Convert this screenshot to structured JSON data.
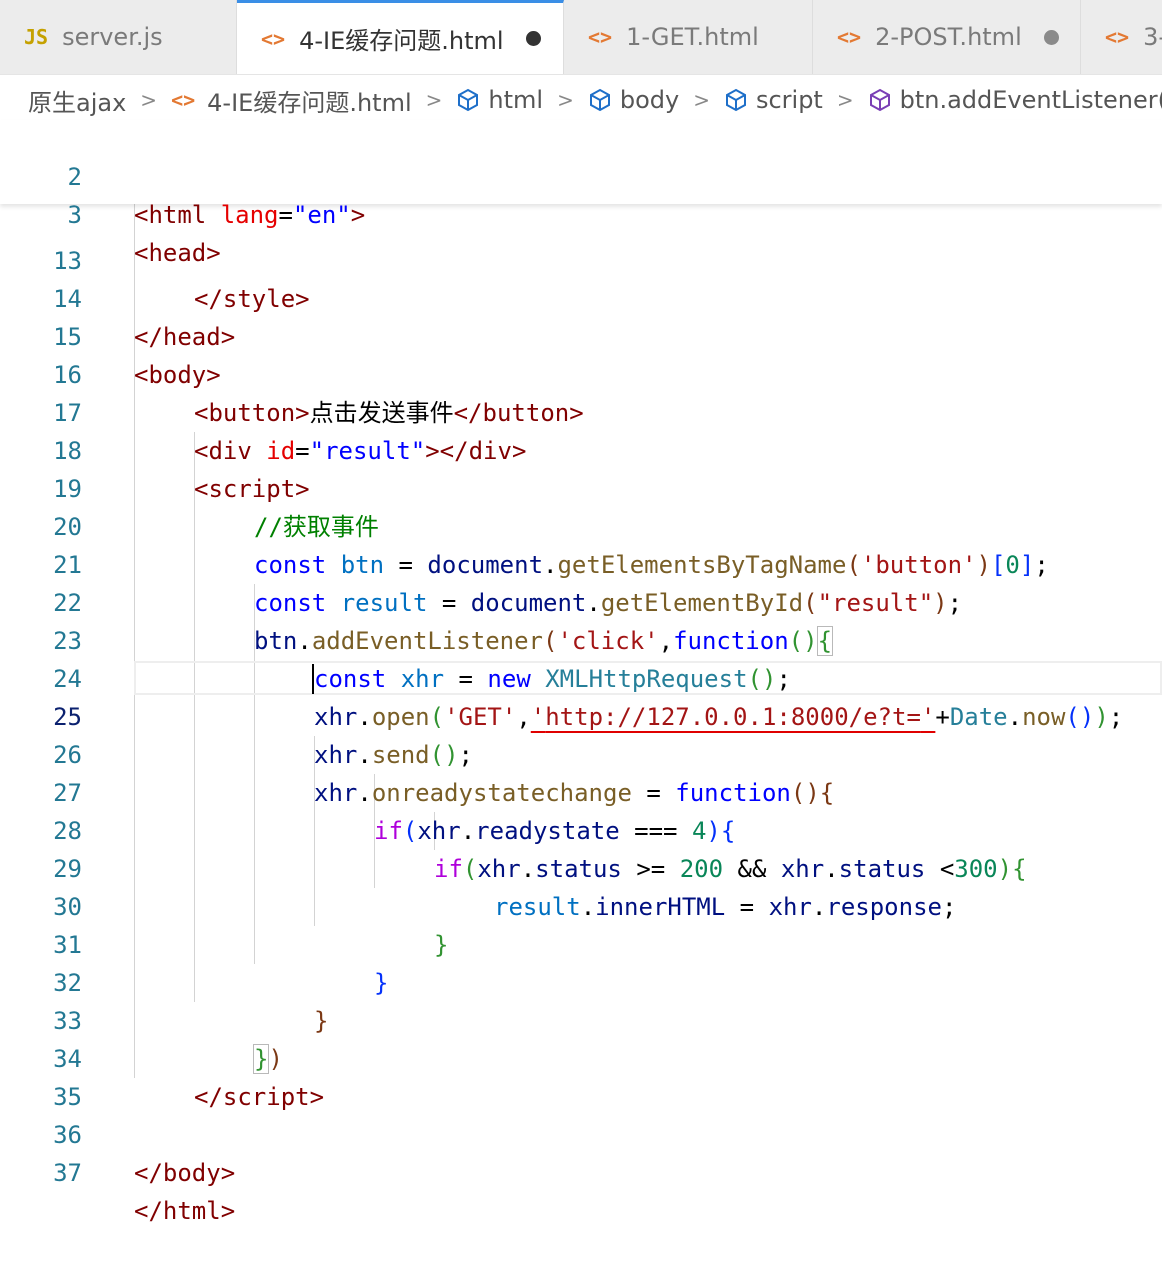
{
  "tabs": [
    {
      "icon": "JS",
      "label": "server.js",
      "active": false,
      "dirty": false
    },
    {
      "icon": "<>",
      "label": "4-IE缓存问题.html",
      "active": true,
      "dirty": true
    },
    {
      "icon": "<>",
      "label": "1-GET.html",
      "active": false,
      "dirty": false
    },
    {
      "icon": "<>",
      "label": "2-POST.html",
      "active": false,
      "dirty": true
    },
    {
      "icon": "<>",
      "label": "3-",
      "active": false,
      "dirty": false
    }
  ],
  "breadcrumb": {
    "folder": "原生ajax",
    "file": "4-IE缓存问题.html",
    "html": "html",
    "body": "body",
    "script": "script",
    "symbol": "btn.addEventListener('click"
  },
  "editor": {
    "current_line": 25,
    "line_numbers": [
      "2",
      "3",
      "13",
      "14",
      "15",
      "16",
      "17",
      "18",
      "19",
      "20",
      "21",
      "22",
      "23",
      "24",
      "25",
      "26",
      "27",
      "28",
      "29",
      "30",
      "31",
      "32",
      "33",
      "34",
      "35",
      "36",
      "37"
    ],
    "t": {
      "lt": "<",
      "gt": ">",
      "ltslash": "</",
      "eq": "=",
      "gtlt": "></",
      "html": "html",
      "head": "head",
      "style": "style",
      "body": "body",
      "button": "button",
      "div": "div",
      "script": "script",
      "lang": "lang",
      "en": "\"en\"",
      "id": "id",
      "result_attr": "\"result\"",
      "button_text": "点击发送事件",
      "comment": "//获取事件",
      "const": "const",
      "btn": "btn",
      "result": "result",
      "document": "document",
      "dot": ".",
      "getElementsByTagName": "getElementsByTagName",
      "s_button": "'button'",
      "lbrack": "[",
      "zero": "0",
      "rbrack": "]",
      "semi": ";",
      "getElementById": "getElementById",
      "s_result": "\"result\"",
      "lparen": "(",
      "rparen": ")",
      "lbrace": "{",
      "rbrace": "}",
      "addEventListener": "addEventListener",
      "s_click": "'click'",
      "comma": ",",
      "function": "function",
      "xhr": "xhr",
      "new": "new",
      "XMLHttpRequest": "XMLHttpRequest",
      "open": "open",
      "s_get": "'GET'",
      "url_q1": "'",
      "url": "http://127.0.0.1:8000/e?t=",
      "url_q2": "'",
      "plus": "+",
      "Date": "Date",
      "now": "now",
      "send": "send",
      "onreadystatechange": "onreadystatechange",
      "if": "if",
      "readystate": "readystate",
      "eq3": "===",
      "four": "4",
      "status": "status",
      "gte": ">=",
      "n200": "200",
      "and": "&&",
      "lt300": "<",
      "n300": "300",
      "innerHTML": "innerHTML",
      "response": "response"
    }
  }
}
